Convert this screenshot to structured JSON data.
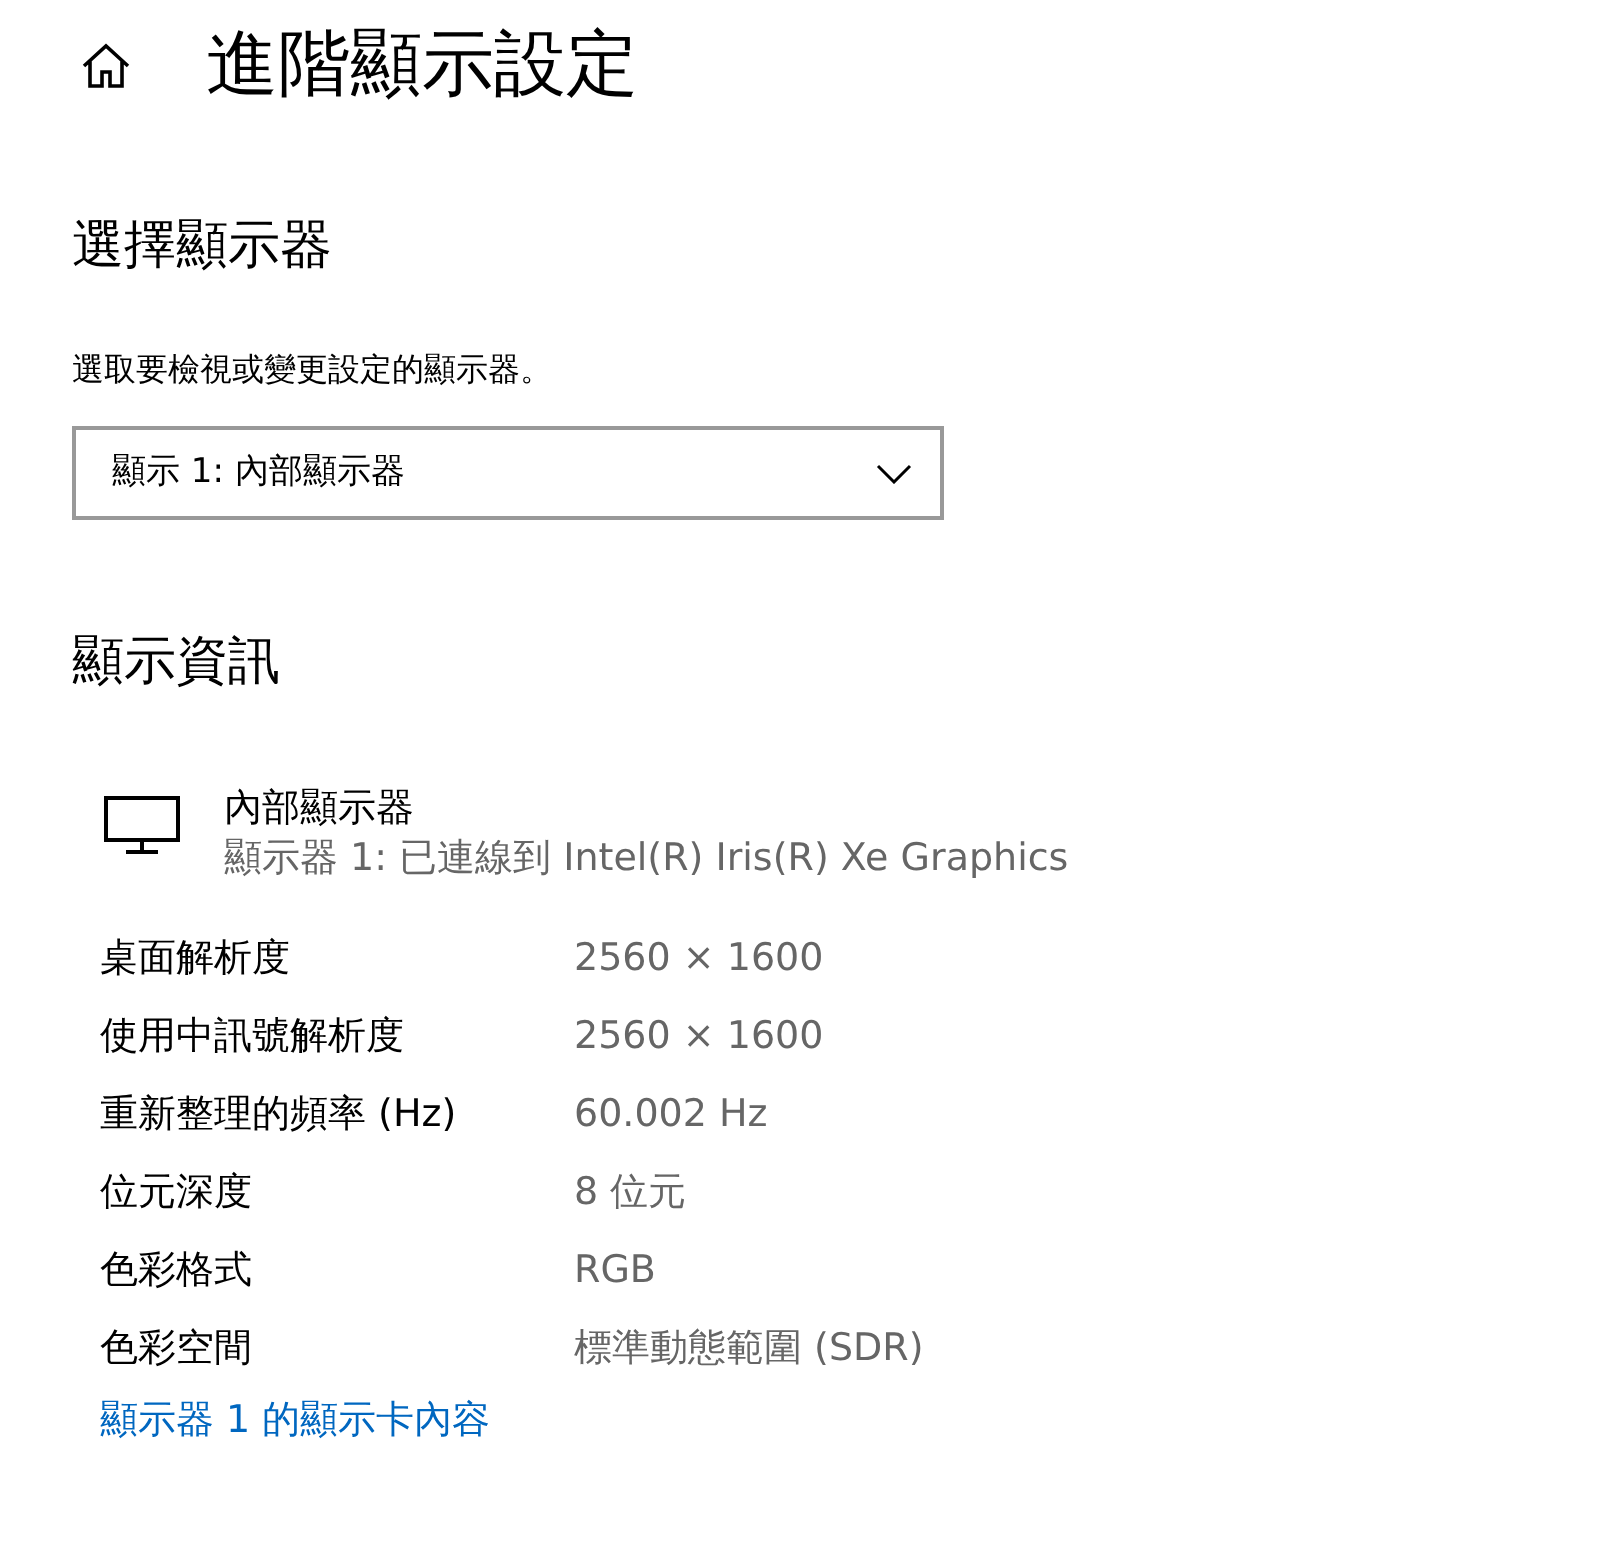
{
  "header": {
    "title": "進階顯示設定"
  },
  "select_display": {
    "heading": "選擇顯示器",
    "description": "選取要檢視或變更設定的顯示器。",
    "dropdown": {
      "value": "顯示 1: 內部顯示器"
    }
  },
  "display_info": {
    "heading": "顯示資訊",
    "monitor": {
      "name": "內部顯示器",
      "subtitle": "顯示器 1: 已連線到 Intel(R) Iris(R) Xe Graphics"
    },
    "rows": [
      {
        "label": "桌面解析度",
        "value": "2560 × 1600"
      },
      {
        "label": "使用中訊號解析度",
        "value": "2560 × 1600"
      },
      {
        "label": "重新整理的頻率 (Hz)",
        "value": "60.002 Hz"
      },
      {
        "label": "位元深度",
        "value": "8 位元"
      },
      {
        "label": "色彩格式",
        "value": "RGB"
      },
      {
        "label": "色彩空間",
        "value": "標準動態範圍 (SDR)"
      }
    ],
    "link": "顯示器 1 的顯示卡內容"
  }
}
